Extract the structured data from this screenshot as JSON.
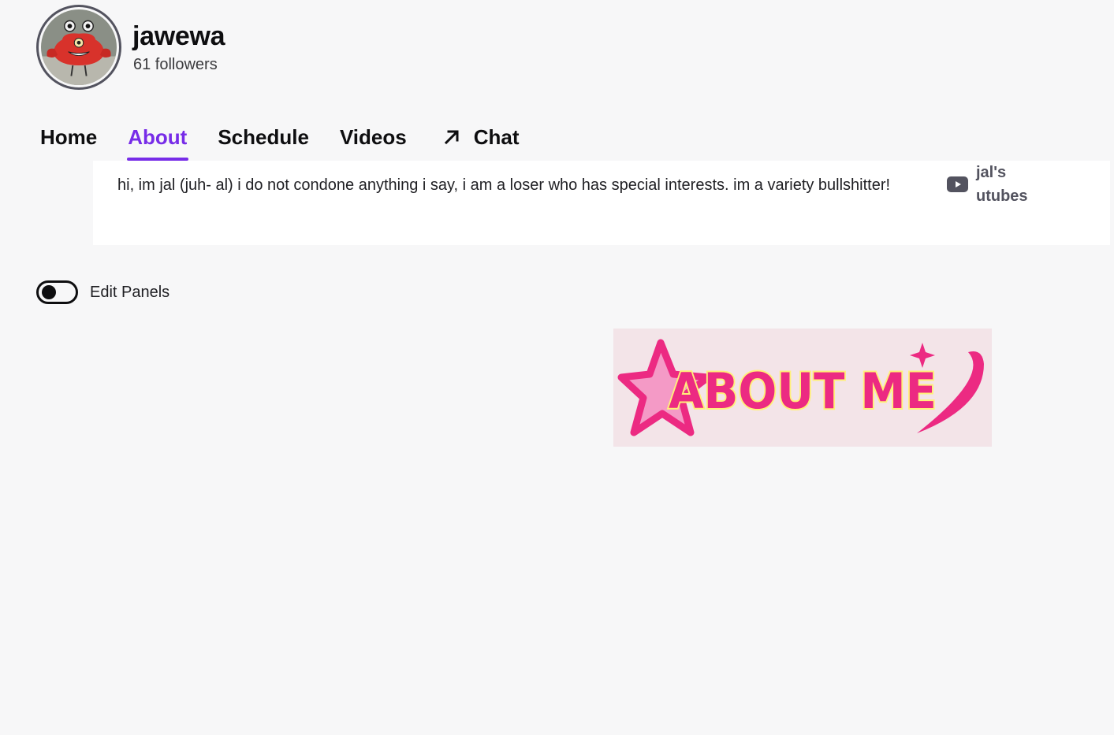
{
  "channel": {
    "name": "jawewa",
    "followers": "61 followers",
    "avatar_icon": "red-creature-avatar"
  },
  "tabs": [
    {
      "label": "Home",
      "active": false
    },
    {
      "label": "About",
      "active": true
    },
    {
      "label": "Schedule",
      "active": false
    },
    {
      "label": "Videos",
      "active": false
    },
    {
      "label": "Chat",
      "active": false,
      "icon": "external-arrow-icon"
    }
  ],
  "about": {
    "bio": "hi, im jal (juh- al) i do not condone anything i say, i am a loser who has special interests. im a variety bullshitter!",
    "social": {
      "icon": "youtube-icon",
      "label": "jal's utubes"
    }
  },
  "edit_panels": {
    "label": "Edit Panels",
    "enabled": false
  },
  "banner": {
    "text": "ABOUT ME",
    "colors": {
      "background": "#f3e4e8",
      "pink": "#ec2a82",
      "light_pink": "#f49ac6",
      "yellow": "#fff07a"
    }
  },
  "colors": {
    "accent": "#772ce8",
    "text": "#0e0e10",
    "page_bg": "#f7f7f8"
  }
}
